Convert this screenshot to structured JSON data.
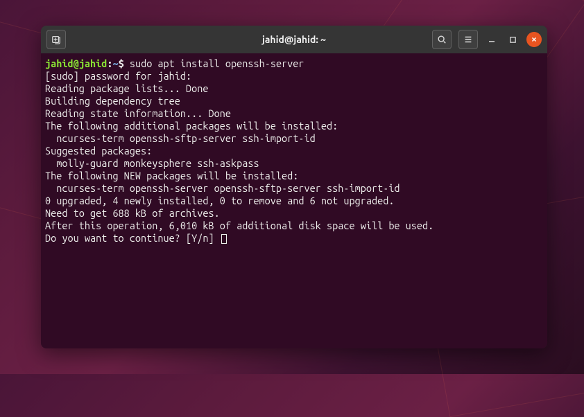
{
  "window": {
    "title": "jahid@jahid: ~"
  },
  "prompt": {
    "user_host": "jahid@jahid",
    "separator": ":",
    "path": "~",
    "symbol": "$ ",
    "command": "sudo apt install openssh-server"
  },
  "output_lines": [
    "[sudo] password for jahid:",
    "Reading package lists... Done",
    "Building dependency tree",
    "Reading state information... Done",
    "The following additional packages will be installed:",
    "  ncurses-term openssh-sftp-server ssh-import-id",
    "Suggested packages:",
    "  molly-guard monkeysphere ssh-askpass",
    "The following NEW packages will be installed:",
    "  ncurses-term openssh-server openssh-sftp-server ssh-import-id",
    "0 upgraded, 4 newly installed, 0 to remove and 6 not upgraded.",
    "Need to get 688 kB of archives.",
    "After this operation, 6,010 kB of additional disk space will be used.",
    "Do you want to continue? [Y/n] "
  ]
}
